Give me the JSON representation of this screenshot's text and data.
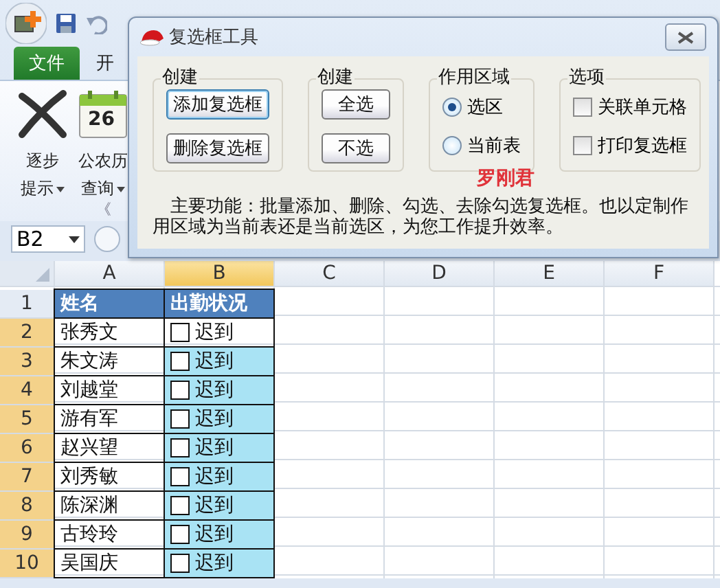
{
  "ribbon": {
    "tabs": [
      {
        "label": "文件",
        "selected": true
      },
      {
        "label": "开",
        "selected": false
      }
    ],
    "commands": [
      {
        "kind": "cross",
        "label": "逐步",
        "menu": "提示"
      },
      {
        "kind": "calendar",
        "day": "26",
        "label": "公农历",
        "menu": "查询"
      }
    ],
    "group_label": "《"
  },
  "formula_bar": {
    "name_box": "B2"
  },
  "sheet": {
    "columns": [
      {
        "label": "A",
        "selected": false
      },
      {
        "label": "B",
        "selected": true
      },
      {
        "label": "C",
        "selected": false
      },
      {
        "label": "D",
        "selected": false
      },
      {
        "label": "E",
        "selected": false
      },
      {
        "label": "F",
        "selected": false
      }
    ],
    "rows": [
      {
        "number": "1",
        "selected": false,
        "kind": "header",
        "name": "姓名",
        "status": "出勤状况"
      },
      {
        "number": "2",
        "selected": true,
        "active": true,
        "kind": "data",
        "name": "张秀文",
        "checked": false,
        "status": "迟到"
      },
      {
        "number": "3",
        "selected": true,
        "active": false,
        "kind": "data",
        "name": "朱文涛",
        "checked": false,
        "status": "迟到"
      },
      {
        "number": "4",
        "selected": true,
        "active": false,
        "kind": "data",
        "name": "刘越堂",
        "checked": false,
        "status": "迟到"
      },
      {
        "number": "5",
        "selected": true,
        "active": false,
        "kind": "data",
        "name": "游有军",
        "checked": false,
        "status": "迟到"
      },
      {
        "number": "6",
        "selected": true,
        "active": false,
        "kind": "data",
        "name": "赵兴望",
        "checked": false,
        "status": "迟到"
      },
      {
        "number": "7",
        "selected": true,
        "active": false,
        "kind": "data",
        "name": "刘秀敏",
        "checked": false,
        "status": "迟到"
      },
      {
        "number": "8",
        "selected": true,
        "active": false,
        "kind": "data",
        "name": "陈深渊",
        "checked": false,
        "status": "迟到"
      },
      {
        "number": "9",
        "selected": true,
        "active": false,
        "kind": "data",
        "name": "古玲玲",
        "checked": false,
        "status": "迟到"
      },
      {
        "number": "10",
        "selected": true,
        "active": false,
        "kind": "data",
        "name": "吴国庆",
        "checked": false,
        "status": "迟到"
      }
    ]
  },
  "dialog": {
    "title": "复选框工具",
    "groups": [
      {
        "title": "创建",
        "kind": "buttons",
        "items": [
          {
            "label": "添加复选框",
            "focused": true
          },
          {
            "label": "删除复选框",
            "focused": false
          }
        ]
      },
      {
        "title": "创建",
        "kind": "buttons",
        "items": [
          {
            "label": "全选",
            "focused": false
          },
          {
            "label": "不选",
            "focused": false
          }
        ]
      },
      {
        "title": "作用区域",
        "kind": "radios",
        "items": [
          {
            "label": "选区",
            "selected": true
          },
          {
            "label": "当前表",
            "selected": false
          }
        ]
      },
      {
        "title": "选项",
        "kind": "checkboxes",
        "items": [
          {
            "label": "关联单元格",
            "checked": false
          },
          {
            "label": "打印复选框",
            "checked": false
          }
        ]
      }
    ],
    "author": "罗刚君",
    "description": "主要功能：批量添加、删除、勾选、去除勾选复选框。也以定制作用区域为当前表还是当前选区，为您工作提升效率。"
  }
}
